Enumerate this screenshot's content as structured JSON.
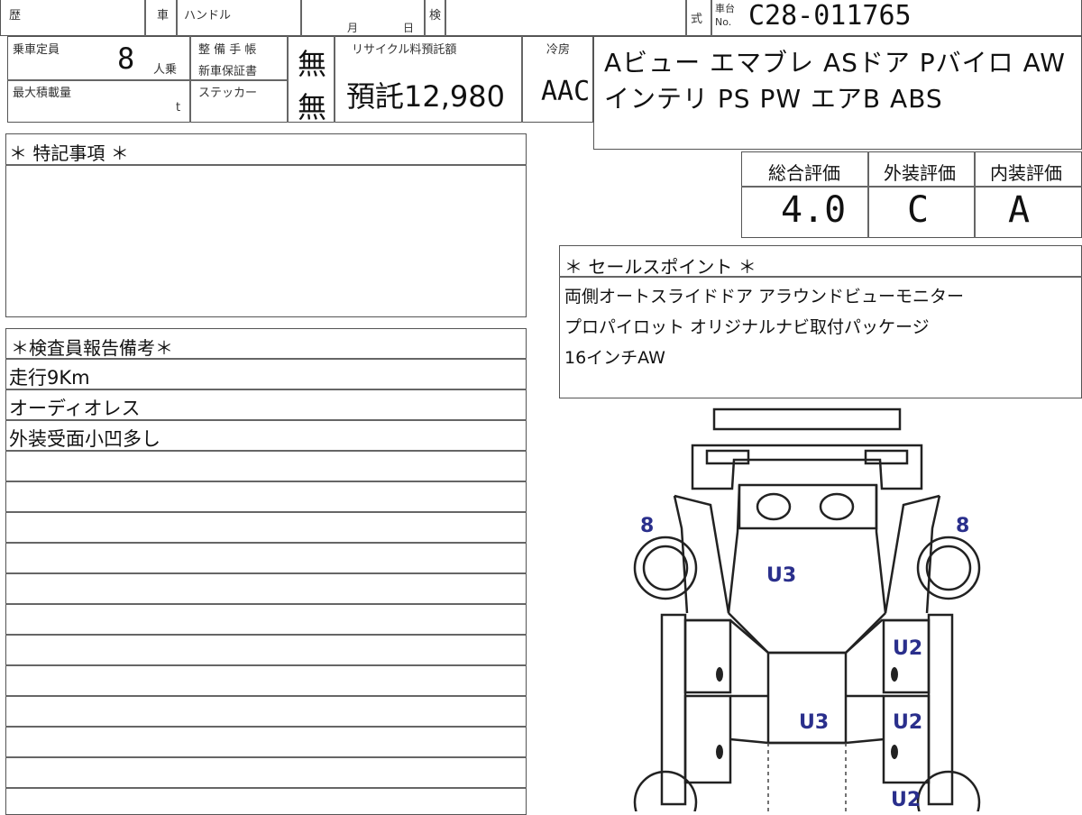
{
  "header": {
    "history_label": "歴",
    "car_label": "車",
    "handle_label": "ハンドル",
    "month_label": "月",
    "day_label": "日",
    "inspection_label": "検",
    "model_label": "式",
    "chassis_label_top": "車台",
    "chassis_label_bottom": "No.",
    "chassis_no": "C28-011765"
  },
  "specs": {
    "capacity_label": "乗車定員",
    "capacity_value": "8",
    "capacity_unit": "人乗",
    "maintenance_label": "整 備 手 帳",
    "warranty_label": "新車保証書",
    "maintenance_value": "無",
    "max_load_label": "最大積載量",
    "max_load_unit": "t",
    "sticker_label": "ステッカー",
    "sticker_value": "無",
    "recycle_label": "リサイクル料預託額",
    "recycle_value": "預託12,980",
    "ac_label": "冷房",
    "ac_value": "AAC"
  },
  "equipment": {
    "line1": "Aビュー エマブレ ASドア Pバイロ AW",
    "line2": "インテリ PS PW エアB ABS"
  },
  "special_notes": {
    "title": "＊ 特記事項 ＊"
  },
  "ratings": {
    "overall_label": "総合評価",
    "exterior_label": "外装評価",
    "interior_label": "内装評価",
    "overall_value": "4.0",
    "exterior_value": "C",
    "interior_value": "A"
  },
  "sales_points": {
    "title": "＊ セールスポイント ＊",
    "lines": [
      "両側オートスライドドア アラウンドビューモニター",
      "プロパイロット オリジナルナビ取付パッケージ",
      "16インチAW"
    ]
  },
  "inspector": {
    "title": "＊検査員報告備考＊",
    "lines": [
      "走行9Km",
      "オーディオレス",
      "外装受面小凹多し"
    ]
  },
  "diagram_marks": {
    "front_left_tire": "8",
    "front_right_tire": "8",
    "hood": "U3",
    "right_front_door": "U2",
    "roof": "U3",
    "right_rear_door": "U2",
    "right_rear_quarter": "U2"
  }
}
